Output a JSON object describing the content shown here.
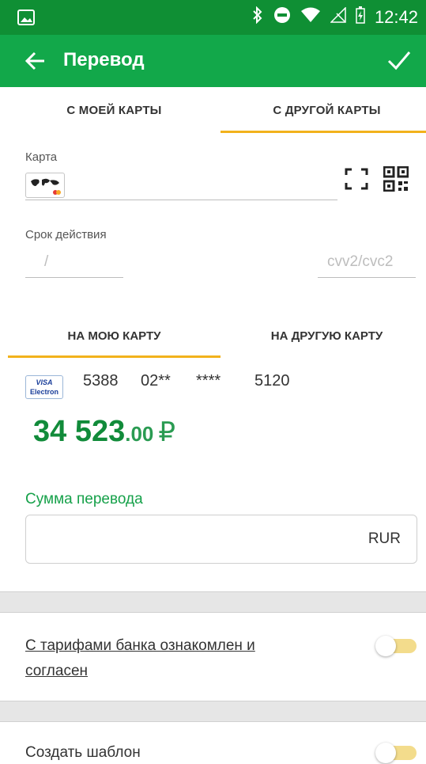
{
  "status_bar": {
    "time": "12:42"
  },
  "app_bar": {
    "title": "Перевод"
  },
  "source_tabs": [
    {
      "label": "С МОЕЙ КАРТЫ",
      "active": false
    },
    {
      "label": "С ДРУГОЙ КАРТЫ",
      "active": true
    }
  ],
  "card_form": {
    "card_label": "Карта",
    "expiry_label": "Срок действия",
    "expiry_placeholder": "/",
    "cvv_placeholder": "cvv2/cvc2"
  },
  "dest_tabs": [
    {
      "label": "НА МОЮ КАРТУ",
      "active": true
    },
    {
      "label": "НА ДРУГУЮ КАРТУ",
      "active": false
    }
  ],
  "dest_card": {
    "brand": {
      "line1": "VISA",
      "line2": "Electron"
    },
    "number_groups": [
      "5388",
      "02**",
      "****",
      "5120"
    ],
    "balance_int": "34 523",
    "balance_frac": ".00",
    "currency": "₽"
  },
  "amount": {
    "label": "Сумма перевода",
    "currency": "RUR"
  },
  "terms": {
    "label": "С тарифами банка ознакомлен и согласен",
    "checked": false
  },
  "template": {
    "label": "Создать шаблон",
    "checked": false
  },
  "colors": {
    "status_bar": "#0f8f34",
    "app_bar": "#12a84a",
    "tab_indicator": "#f2b21c",
    "accent_green": "#16a14a"
  }
}
